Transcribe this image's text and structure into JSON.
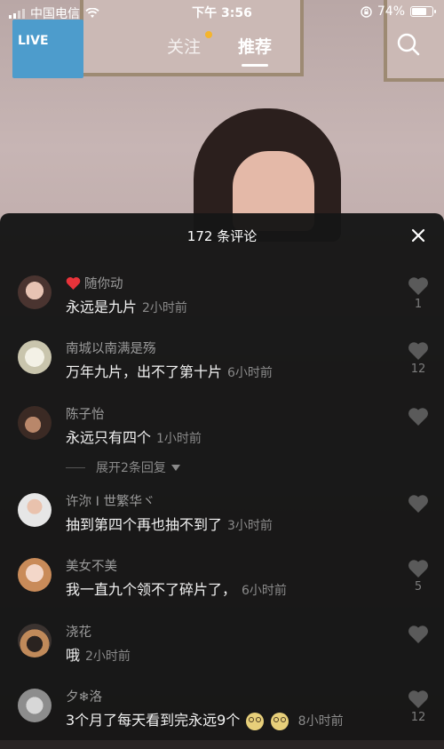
{
  "status_bar": {
    "carrier": "中国电信",
    "time": "下午 3:56",
    "battery": "74%",
    "battery_level": 0.74
  },
  "nav": {
    "live_label": "LIVE",
    "tabs": [
      {
        "label": "关注"
      },
      {
        "label": "推荐"
      }
    ]
  },
  "panel": {
    "title": "172 条评论"
  },
  "comments": [
    {
      "username": "随你动",
      "text": "永远是九片",
      "time": "2小时前",
      "likes": "1",
      "badge": "heart"
    },
    {
      "username": "南城以南满是殇",
      "text": "万年九片，出不了第十片",
      "time": "6小时前",
      "likes": "12"
    },
    {
      "username": "陈子怡",
      "text": "永远只有四个",
      "time": "1小时前",
      "likes": ""
    },
    {
      "username": "许沵 I 世繁华ヾ",
      "text": "抽到第四个再也抽不到了",
      "time": "3小时前",
      "likes": ""
    },
    {
      "username": "美女不美",
      "text": "我一直九个领不了碎片了，",
      "time": "6小时前",
      "likes": "5"
    },
    {
      "username": "浇花",
      "text": "哦",
      "time": "2小时前",
      "likes": ""
    },
    {
      "username": "夕❄洛",
      "text": "3个月了每天看到完永远9个",
      "time": "8小时前",
      "likes": "12"
    }
  ],
  "expand_replies": "展开2条回复",
  "colors": {
    "panel_bg": "#161616",
    "text_primary": "#f2f2f2",
    "text_secondary": "#9b9b9b",
    "heart_red": "#e8333a",
    "dot_orange": "#f5b52d"
  }
}
